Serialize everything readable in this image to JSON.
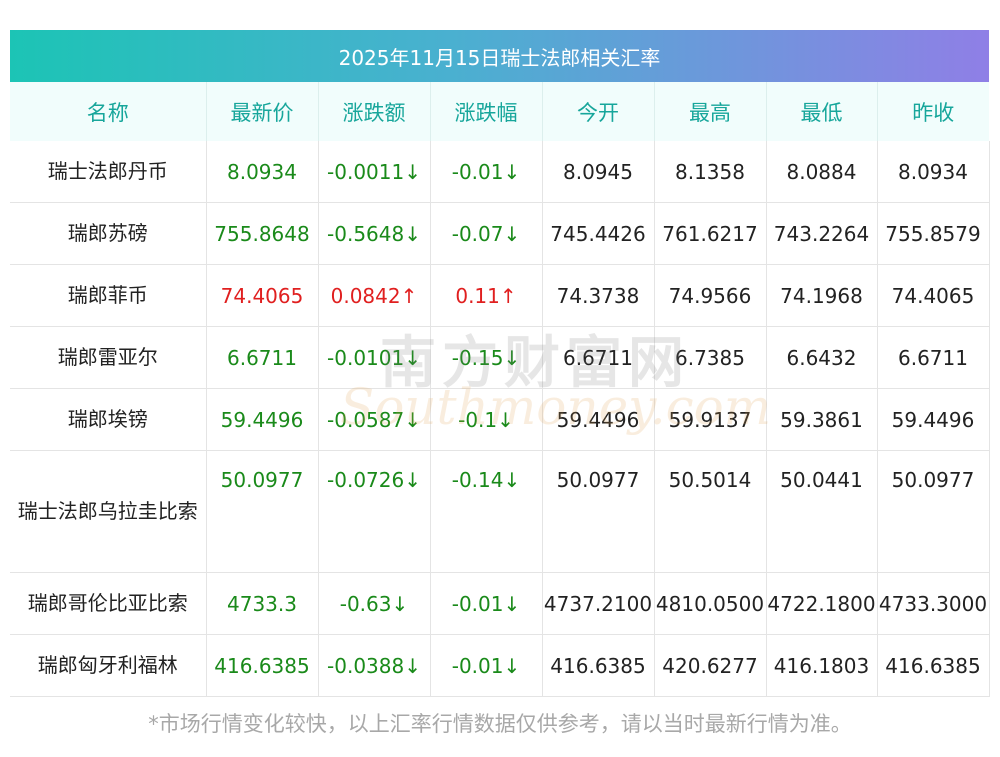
{
  "title": "2025年11月15日瑞士法郎相关汇率",
  "headers": [
    "名称",
    "最新价",
    "涨跌额",
    "涨跌幅",
    "今开",
    "最高",
    "最低",
    "昨收"
  ],
  "rows": [
    {
      "name": "瑞士法郎丹币",
      "latest": "8.0934",
      "change": "-0.0011↓",
      "pct": "-0.01↓",
      "open": "8.0945",
      "high": "8.1358",
      "low": "8.0884",
      "prev": "8.0934",
      "dir": "down"
    },
    {
      "name": "瑞郎苏磅",
      "latest": "755.8648",
      "change": "-0.5648↓",
      "pct": "-0.07↓",
      "open": "745.4426",
      "high": "761.6217",
      "low": "743.2264",
      "prev": "755.8579",
      "dir": "down"
    },
    {
      "name": "瑞郎菲币",
      "latest": "74.4065",
      "change": "0.0842↑",
      "pct": "0.11↑",
      "open": "74.3738",
      "high": "74.9566",
      "low": "74.1968",
      "prev": "74.4065",
      "dir": "up"
    },
    {
      "name": "瑞郎雷亚尔",
      "latest": "6.6711",
      "change": "-0.0101↓",
      "pct": "-0.15↓",
      "open": "6.6711",
      "high": "6.7385",
      "low": "6.6432",
      "prev": "6.6711",
      "dir": "down"
    },
    {
      "name": "瑞郎埃镑",
      "latest": "59.4496",
      "change": "-0.0587↓",
      "pct": "-0.1↓",
      "open": "59.4496",
      "high": "59.9137",
      "low": "59.3861",
      "prev": "59.4496",
      "dir": "down"
    },
    {
      "name": "瑞士法郎乌拉圭比索",
      "latest": "50.0977",
      "change": "-0.0726↓",
      "pct": "-0.14↓",
      "open": "50.0977",
      "high": "50.5014",
      "low": "50.0441",
      "prev": "50.0977",
      "dir": "down"
    },
    {
      "name": "瑞郎哥伦比亚比索",
      "latest": "4733.3",
      "change": "-0.63↓",
      "pct": "-0.01↓",
      "open": "4737.2100",
      "high": "4810.0500",
      "low": "4722.1800",
      "prev": "4733.3000",
      "dir": "down"
    },
    {
      "name": "瑞郎匈牙利福林",
      "latest": "416.6385",
      "change": "-0.0388↓",
      "pct": "-0.01↓",
      "open": "416.6385",
      "high": "420.6277",
      "low": "416.1803",
      "prev": "416.6385",
      "dir": "down"
    }
  ],
  "watermark": {
    "cn": "南方财富网",
    "en": "Southmoney.com"
  },
  "footer": "*市场行情变化较快，以上汇率行情数据仅供参考，请以当时最新行情为准。",
  "colors": {
    "up": "#e01f1f",
    "down": "#1a8a1a",
    "header_text": "#17a69b",
    "gradient_start": "#1cc4b5",
    "gradient_end": "#8f7fe6"
  }
}
